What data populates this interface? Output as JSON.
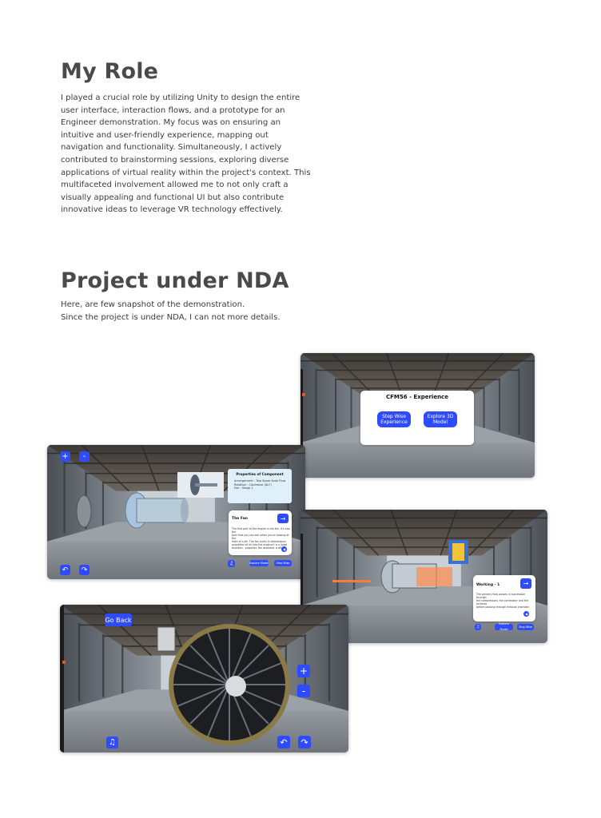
{
  "role": {
    "title": "My Role",
    "body": " I played a crucial role by utilizing Unity to design the entire\nuser interface, interaction flows, and a prototype for an\nEngineer demonstration. My focus was on ensuring an\nintuitive and user-friendly experience, mapping out\nnavigation and functionality. Simultaneously, I actively\ncontributed to brainstorming sessions, exploring diverse\napplications of virtual reality within the project's context. This\nmultifaceted involvement allowed me to not only craft a\nvisually appealing and functional UI but also contribute\ninnovative ideas to leverage VR technology effectively."
  },
  "nda": {
    "title": "Project under NDA",
    "body": "Here, are few snapshot of the demonstration.\nSince the project is under NDA, I can not more details."
  },
  "shot_experience": {
    "title": "CFM56 - Experience",
    "step_wise_button": "Step Wise\nExperience",
    "explore_button": "Explore 3D\nModel"
  },
  "shot_properties": {
    "plus_label": "+",
    "minus_label": "-",
    "properties_title": "Properties of Component",
    "properties_text": "Arrangement : Two Spool Axial Flow\nRotation : Clockwise (ALF)\nFan : Stage 1",
    "info_title": "The Fan",
    "info_text": "The first part of the engine is the fan. It's also the\npart that you can see when you're looking at the\nfront of a jet. The fan sucks in tremendous\nquantities of air into the engine.It is a large\nfourteen - propeller. Fan diameter is 68.3in",
    "explore_model_button": "Explore Model",
    "step_wise_button": "Step Wise"
  },
  "shot_working": {
    "info_title": "Working - 1",
    "info_text": "The primary flow passes in succession through\nthe compressors, the combustor and the turbines\nbefore passing through exhaust chamber",
    "explore_model_button": "Explore Model",
    "step_wise_button": "Step Wise"
  },
  "shot_fan": {
    "go_back_button": "Go Back",
    "plus_label": "+",
    "minus_label": "-"
  },
  "colors": {
    "accent": "#2f4bff",
    "heading": "#4a4a4a",
    "body_text": "#3c3c3c"
  }
}
